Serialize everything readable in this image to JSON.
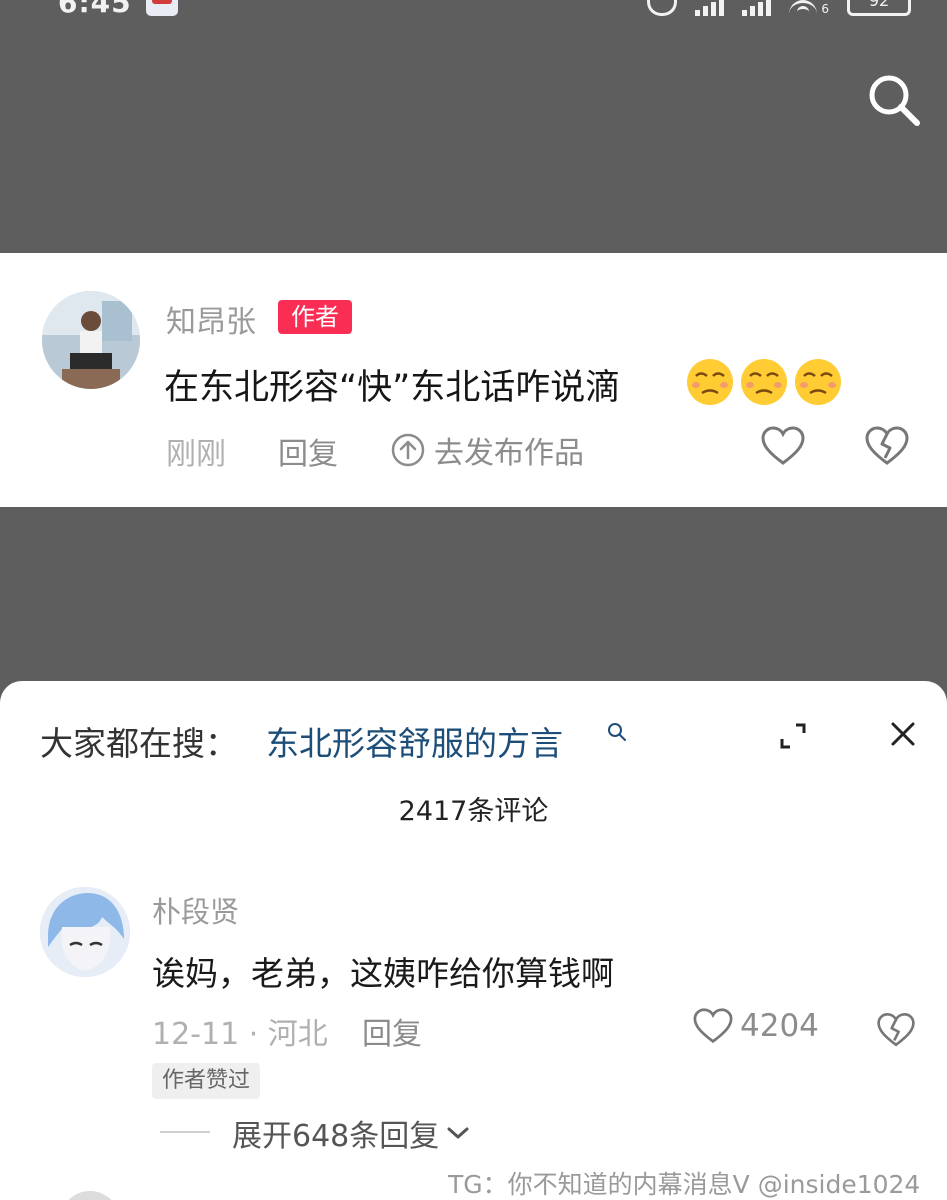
{
  "status_bar": {
    "time": "6:45",
    "battery": "92",
    "wifi_sub": "6"
  },
  "pinned_comment": {
    "username": "知昂张",
    "author_badge": "作者",
    "text": "在东北形容“快”东北话咋说滴",
    "emoji_icons": [
      "smug-face-icon",
      "smug-face-icon",
      "smug-face-icon"
    ],
    "time": "刚刚",
    "reply_label": "回复",
    "publish_label": "去发布作品"
  },
  "sheet": {
    "search_label": "大家都在搜：",
    "search_term": "东北形容舒服的方言",
    "comment_count": "2417条评论"
  },
  "comment": {
    "username": "朴段贤",
    "text": "诶妈，老弟，这姨咋给你算钱啊",
    "date_location": "12-11 · 河北",
    "reply_label": "回复",
    "like_count": "4204",
    "author_liked": "作者赞过",
    "expand_replies": "展开648条回复"
  },
  "watermark": "TG：你不知道的内幕消息V @inside1024",
  "colors": {
    "backdrop": "#5e5e5e",
    "author_badge": "#fa2d55",
    "search_term": "#1d4e7a"
  }
}
